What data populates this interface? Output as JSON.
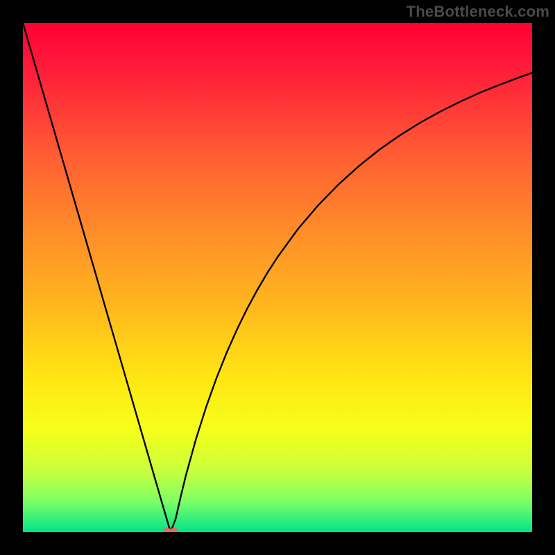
{
  "watermark": "TheBottleneck.com",
  "colors": {
    "frame": "#000000",
    "curve": "#000000",
    "marker_fill": "#e8695c",
    "gradient_stops": [
      {
        "offset": 0.0,
        "color": "#ff0033"
      },
      {
        "offset": 0.1,
        "color": "#ff1f3a"
      },
      {
        "offset": 0.25,
        "color": "#ff5a33"
      },
      {
        "offset": 0.4,
        "color": "#ff8a2a"
      },
      {
        "offset": 0.55,
        "color": "#ffb51e"
      },
      {
        "offset": 0.7,
        "color": "#ffe712"
      },
      {
        "offset": 0.8,
        "color": "#f6ff1a"
      },
      {
        "offset": 0.88,
        "color": "#c8ff3d"
      },
      {
        "offset": 0.94,
        "color": "#7dff66"
      },
      {
        "offset": 1.0,
        "color": "#00e38a"
      }
    ]
  },
  "chart_data": {
    "type": "line",
    "title": "",
    "xlabel": "",
    "ylabel": "",
    "xlim": [
      0,
      100
    ],
    "ylim": [
      0,
      100
    ],
    "x": [
      0,
      2,
      4,
      6,
      8,
      10,
      12,
      14,
      16,
      18,
      20,
      22,
      24,
      26,
      28,
      29,
      30,
      31,
      32,
      34,
      36,
      38,
      40,
      42,
      44,
      46,
      48,
      50,
      54,
      58,
      62,
      66,
      70,
      74,
      78,
      82,
      86,
      90,
      94,
      98,
      100
    ],
    "values": [
      100,
      93.1,
      86.2,
      79.3,
      72.4,
      65.5,
      58.6,
      51.7,
      44.8,
      37.9,
      31.0,
      24.1,
      17.2,
      10.3,
      3.4,
      0.0,
      2.6,
      7.0,
      11.1,
      18.3,
      24.6,
      30.2,
      35.2,
      39.7,
      43.8,
      47.5,
      50.9,
      54.0,
      59.5,
      64.2,
      68.3,
      71.9,
      75.1,
      77.9,
      80.4,
      82.6,
      84.6,
      86.4,
      88.0,
      89.5,
      90.2
    ],
    "minimum_marker": {
      "x": 29,
      "y": 0
    }
  }
}
